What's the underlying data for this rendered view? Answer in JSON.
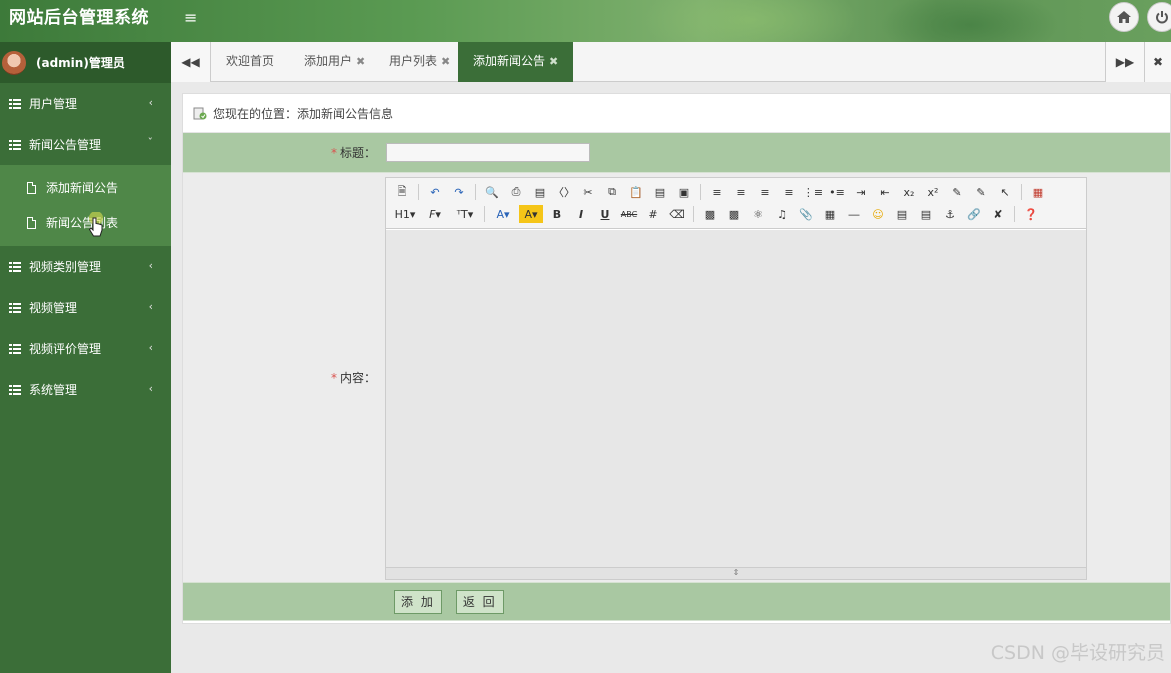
{
  "app": {
    "title": "网站后台管理系统"
  },
  "user": {
    "name": "(admin)管理员"
  },
  "sidebar": {
    "items": [
      {
        "label": "用户管理"
      },
      {
        "label": "新闻公告管理",
        "children": [
          {
            "label": "添加新闻公告"
          },
          {
            "label": "新闻公告列表"
          }
        ]
      },
      {
        "label": "视频类别管理"
      },
      {
        "label": "视频管理"
      },
      {
        "label": "视频评价管理"
      },
      {
        "label": "系统管理"
      }
    ]
  },
  "tabs": [
    {
      "label": "欢迎首页"
    },
    {
      "label": "添加用户"
    },
    {
      "label": "用户列表"
    },
    {
      "label": "添加新闻公告",
      "active": true
    }
  ],
  "breadcrumb": {
    "text": "您现在的位置：添加新闻公告信息"
  },
  "form": {
    "title_label": "标题：",
    "title_value": "",
    "content_label": "内容："
  },
  "actions": {
    "add_label": "添 加",
    "back_label": "返 回"
  },
  "watermark": "CSDN @毕设研究员",
  "colors": {
    "sidebar": "#3b6e38",
    "accent": "#a9c8a2",
    "active_tab": "#3b6e38"
  }
}
